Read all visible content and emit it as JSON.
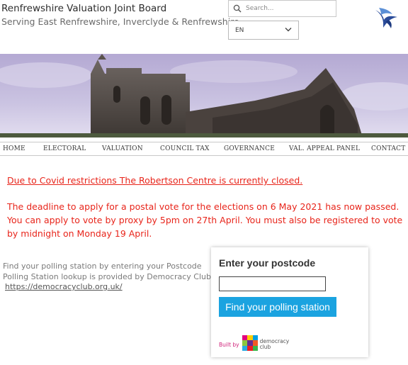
{
  "header": {
    "title": "Renfrewshire Valuation Joint Board",
    "subtitle": "Serving East Renfrewshire, Inverclyde & Renfrewshire",
    "search_placeholder": "Search...",
    "language": "EN"
  },
  "nav": {
    "items": [
      "HOME",
      "ELECTORAL",
      "VALUATION",
      "COUNCIL TAX",
      "GOVERNANCE",
      "VAL. APPEAL PANEL",
      "CONTACT"
    ]
  },
  "notices": {
    "closed": "Due to Covid restrictions The Robertson Centre is currently closed.",
    "deadline_line1": "The deadline to apply for a postal vote for the elections on 6 May 2021 has now passed.",
    "deadline_line2": "You can apply to vote by proxy by 5pm on 27th April. You must also be registered to vote",
    "deadline_line3": "by midnight on Monday 19 April.",
    "color": "#e8251b"
  },
  "polling_info": {
    "line1": "Find your polling station by entering your Postcode",
    "line2": "Polling Station lookup is provided by Democracy Club",
    "link": "https://democracyclub.org.uk/"
  },
  "postcode_widget": {
    "title": "Enter your postcode",
    "postcode_value": "",
    "button_label": "Find your polling station",
    "button_color": "#1ba3e0",
    "built_by": "Built by",
    "brand_line1": "democracy",
    "brand_line2": "club"
  },
  "icons": {
    "search": "search-icon",
    "dropdown": "chevron-down-icon",
    "logo": "bird-logo-icon"
  }
}
